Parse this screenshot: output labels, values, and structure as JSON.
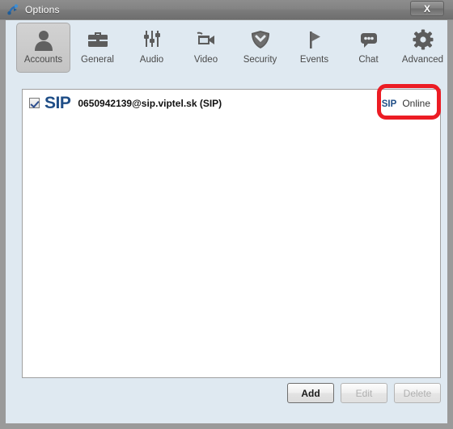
{
  "window": {
    "title": "Options",
    "title_icon": "jitsi-app-icon",
    "close_label": "X"
  },
  "toolbar": {
    "items": [
      {
        "label": "Accounts",
        "icon": "person-icon",
        "selected": true
      },
      {
        "label": "General",
        "icon": "briefcase-icon",
        "selected": false
      },
      {
        "label": "Audio",
        "icon": "sliders-icon",
        "selected": false
      },
      {
        "label": "Video",
        "icon": "camcorder-icon",
        "selected": false
      },
      {
        "label": "Security",
        "icon": "shield-icon",
        "selected": false
      },
      {
        "label": "Events",
        "icon": "flag-icon",
        "selected": false
      },
      {
        "label": "Chat",
        "icon": "speech-bubble-icon",
        "selected": false
      },
      {
        "label": "Advanced",
        "icon": "gear-icon",
        "selected": false
      }
    ]
  },
  "accounts": {
    "rows": [
      {
        "checked": true,
        "protocol_logo": "SIP",
        "name": "0650942139@sip.viptel.sk (SIP)",
        "status_protocol": "SIP",
        "status": "Online",
        "highlighted": true
      }
    ]
  },
  "annotation": {
    "color": "#ec1c24",
    "shape": "rounded-rectangle",
    "target": "account-status"
  },
  "footer": {
    "add_label": "Add",
    "edit_label": "Edit",
    "delete_label": "Delete"
  },
  "colors": {
    "dialog_background": "#dfe9f1",
    "titlebar": "#808080",
    "accent_blue": "#1f4e87",
    "annotation_red": "#ec1c24"
  }
}
